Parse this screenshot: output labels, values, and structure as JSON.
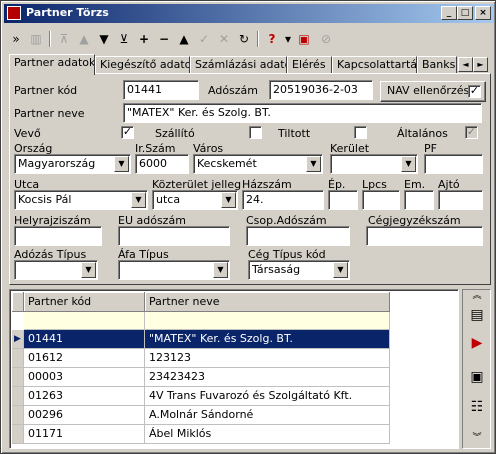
{
  "window": {
    "title": "Partner Törzs"
  },
  "tabs": [
    "Partner adatok",
    "Kiegészítő adatok",
    "Számlázási adatok",
    "Elérés",
    "Kapcsolattartás",
    "Banks"
  ],
  "form": {
    "partner_kod_label": "Partner kód",
    "partner_kod": "01441",
    "adoszam_label": "Adószám",
    "adoszam": "20519036-2-03",
    "nav_button": "NAV ellenőrzés",
    "partner_neve_label": "Partner neve",
    "partner_neve": "\"MATEX\" Ker. és Szolg. BT.",
    "vevo_label": "Vevő",
    "szallito_label": "Szállító",
    "tiltott_label": "Tiltott",
    "altalanos_label": "Általános",
    "orszag_label": "Ország",
    "orszag": "Magyarország",
    "irszam_label": "Ir.Szám",
    "irszam": "6000",
    "varos_label": "Város",
    "varos": "Kecskemét",
    "kerulet_label": "Kerület",
    "pf_label": "PF",
    "utca_label": "Utca",
    "utca": "Kocsis Pál",
    "kozterulet_label": "Közterület jelleg",
    "kozterulet": "utca",
    "hazszam_label": "Házszám",
    "hazszam": "24.",
    "ep_label": "Ép.",
    "lpcs_label": "Lpcs",
    "em_label": "Em.",
    "ajto_label": "Ajtó",
    "helyrajzi_label": "Helyrajziszám",
    "eu_label": "EU adószám",
    "csop_label": "Csop.Adószám",
    "cegjegyzek_label": "Cégjegyzékszám",
    "adozas_label": "Adózás Típus",
    "afa_label": "Áfa Típus",
    "ceg_tipus_label": "Cég Típus kód",
    "ceg_tipus": "Társaság"
  },
  "checks": {
    "vevo": true,
    "szallito": false,
    "tiltott": false,
    "altalanos": true
  },
  "grid": {
    "columns": [
      "Partner kód",
      "Partner neve"
    ],
    "rows": [
      [
        "01441",
        "\"MATEX\" Ker. és Szolg. BT."
      ],
      [
        "01612",
        "123123"
      ],
      [
        "00003",
        "23423423"
      ],
      [
        "01263",
        "4V Trans Fuvarozó és Szolgáltató Kft."
      ],
      [
        "00296",
        "A.Molnár Sándorné"
      ],
      [
        "01171",
        "Ábel Miklós"
      ]
    ]
  }
}
